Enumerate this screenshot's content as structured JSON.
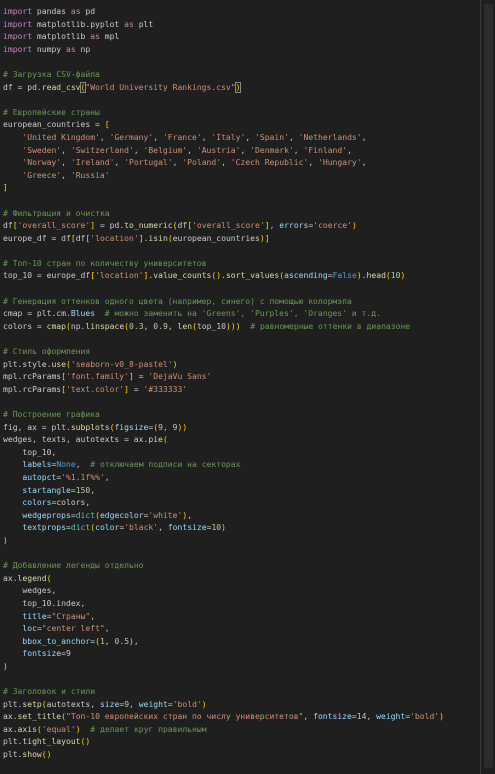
{
  "editor": {
    "lines": [
      [
        {
          "t": "import",
          "c": "kw"
        },
        {
          "t": " pandas ",
          "c": "id"
        },
        {
          "t": "as",
          "c": "kw"
        },
        {
          "t": " pd",
          "c": "id"
        }
      ],
      [
        {
          "t": "import",
          "c": "kw"
        },
        {
          "t": " matplotlib.pyplot ",
          "c": "id"
        },
        {
          "t": "as",
          "c": "kw"
        },
        {
          "t": " plt",
          "c": "id"
        }
      ],
      [
        {
          "t": "import",
          "c": "kw"
        },
        {
          "t": " matplotlib ",
          "c": "id"
        },
        {
          "t": "as",
          "c": "kw"
        },
        {
          "t": " mpl",
          "c": "id"
        }
      ],
      [
        {
          "t": "import",
          "c": "kw"
        },
        {
          "t": " numpy ",
          "c": "id"
        },
        {
          "t": "as",
          "c": "kw"
        },
        {
          "t": " np",
          "c": "id"
        }
      ],
      [],
      [
        {
          "t": "# Загрузка CSV-файла",
          "c": "com"
        }
      ],
      [
        {
          "t": "df = pd.",
          "c": "id"
        },
        {
          "t": "read_csv",
          "c": "fn"
        },
        {
          "t": "(",
          "c": "br",
          "h": true
        },
        {
          "t": "\"World University Rankings.csv\"",
          "c": "str"
        },
        {
          "t": ")",
          "c": "br",
          "h": true
        }
      ],
      [],
      [
        {
          "t": "# Европейские страны",
          "c": "com"
        }
      ],
      [
        {
          "t": "european_countries = ",
          "c": "id"
        },
        {
          "t": "[",
          "c": "br"
        }
      ],
      [
        {
          "t": "    ",
          "c": "id"
        },
        {
          "t": "'United Kingdom'",
          "c": "str"
        },
        {
          "t": ", ",
          "c": "id"
        },
        {
          "t": "'Germany'",
          "c": "str"
        },
        {
          "t": ", ",
          "c": "id"
        },
        {
          "t": "'France'",
          "c": "str"
        },
        {
          "t": ", ",
          "c": "id"
        },
        {
          "t": "'Italy'",
          "c": "str"
        },
        {
          "t": ", ",
          "c": "id"
        },
        {
          "t": "'Spain'",
          "c": "str"
        },
        {
          "t": ", ",
          "c": "id"
        },
        {
          "t": "'Netherlands'",
          "c": "str"
        },
        {
          "t": ",",
          "c": "id"
        }
      ],
      [
        {
          "t": "    ",
          "c": "id"
        },
        {
          "t": "'Sweden'",
          "c": "str"
        },
        {
          "t": ", ",
          "c": "id"
        },
        {
          "t": "'Switzerland'",
          "c": "str"
        },
        {
          "t": ", ",
          "c": "id"
        },
        {
          "t": "'Belgium'",
          "c": "str"
        },
        {
          "t": ", ",
          "c": "id"
        },
        {
          "t": "'Austria'",
          "c": "str"
        },
        {
          "t": ", ",
          "c": "id"
        },
        {
          "t": "'Denmark'",
          "c": "str"
        },
        {
          "t": ", ",
          "c": "id"
        },
        {
          "t": "'Finland'",
          "c": "str"
        },
        {
          "t": ",",
          "c": "id"
        }
      ],
      [
        {
          "t": "    ",
          "c": "id"
        },
        {
          "t": "'Norway'",
          "c": "str"
        },
        {
          "t": ", ",
          "c": "id"
        },
        {
          "t": "'Ireland'",
          "c": "str"
        },
        {
          "t": ", ",
          "c": "id"
        },
        {
          "t": "'Portugal'",
          "c": "str"
        },
        {
          "t": ", ",
          "c": "id"
        },
        {
          "t": "'Poland'",
          "c": "str"
        },
        {
          "t": ", ",
          "c": "id"
        },
        {
          "t": "'Czech Republic'",
          "c": "str"
        },
        {
          "t": ", ",
          "c": "id"
        },
        {
          "t": "'Hungary'",
          "c": "str"
        },
        {
          "t": ",",
          "c": "id"
        }
      ],
      [
        {
          "t": "    ",
          "c": "id"
        },
        {
          "t": "'Greece'",
          "c": "str"
        },
        {
          "t": ", ",
          "c": "id"
        },
        {
          "t": "'Russia'",
          "c": "str"
        }
      ],
      [
        {
          "t": "]",
          "c": "br"
        }
      ],
      [],
      [
        {
          "t": "# Фильтрация и очистка",
          "c": "com"
        }
      ],
      [
        {
          "t": "df",
          "c": "id"
        },
        {
          "t": "[",
          "c": "br"
        },
        {
          "t": "'overall_score'",
          "c": "str"
        },
        {
          "t": "]",
          "c": "br"
        },
        {
          "t": " = pd.",
          "c": "id"
        },
        {
          "t": "to_numeric",
          "c": "fn"
        },
        {
          "t": "(",
          "c": "br"
        },
        {
          "t": "df",
          "c": "id"
        },
        {
          "t": "[",
          "c": "br"
        },
        {
          "t": "'overall_score'",
          "c": "str"
        },
        {
          "t": "]",
          "c": "br"
        },
        {
          "t": ", ",
          "c": "id"
        },
        {
          "t": "errors",
          "c": "var"
        },
        {
          "t": "=",
          "c": "id"
        },
        {
          "t": "'coerce'",
          "c": "str"
        },
        {
          "t": ")",
          "c": "br"
        }
      ],
      [
        {
          "t": "europe_df = df",
          "c": "id"
        },
        {
          "t": "[",
          "c": "br"
        },
        {
          "t": "df",
          "c": "id"
        },
        {
          "t": "[",
          "c": "br"
        },
        {
          "t": "'location'",
          "c": "str"
        },
        {
          "t": "]",
          "c": "br"
        },
        {
          "t": ".",
          "c": "id"
        },
        {
          "t": "isin",
          "c": "fn"
        },
        {
          "t": "(",
          "c": "br"
        },
        {
          "t": "european_countries",
          "c": "id"
        },
        {
          "t": ")",
          "c": "br"
        },
        {
          "t": "]",
          "c": "br"
        }
      ],
      [],
      [
        {
          "t": "# Топ-10 стран по количеству университетов",
          "c": "com"
        }
      ],
      [
        {
          "t": "top_10 = europe_df",
          "c": "id"
        },
        {
          "t": "[",
          "c": "br"
        },
        {
          "t": "'location'",
          "c": "str"
        },
        {
          "t": "]",
          "c": "br"
        },
        {
          "t": ".",
          "c": "id"
        },
        {
          "t": "value_counts",
          "c": "fn"
        },
        {
          "t": "()",
          "c": "br"
        },
        {
          "t": ".",
          "c": "id"
        },
        {
          "t": "sort_values",
          "c": "fn"
        },
        {
          "t": "(",
          "c": "br"
        },
        {
          "t": "ascending",
          "c": "var"
        },
        {
          "t": "=",
          "c": "id"
        },
        {
          "t": "False",
          "c": "const"
        },
        {
          "t": ")",
          "c": "br"
        },
        {
          "t": ".",
          "c": "id"
        },
        {
          "t": "head",
          "c": "fn"
        },
        {
          "t": "(",
          "c": "br"
        },
        {
          "t": "10",
          "c": "num"
        },
        {
          "t": ")",
          "c": "br"
        }
      ],
      [],
      [
        {
          "t": "# Генерация оттенков одного цвета (например, синего) с помощью колормэпа",
          "c": "com"
        }
      ],
      [
        {
          "t": "cmap = plt.cm.",
          "c": "id"
        },
        {
          "t": "Blues",
          "c": "var"
        },
        {
          "t": "  ",
          "c": "id"
        },
        {
          "t": "# можно заменить на 'Greens', 'Purples', 'Oranges' и т.д.",
          "c": "com"
        }
      ],
      [
        {
          "t": "colors = ",
          "c": "id"
        },
        {
          "t": "cmap",
          "c": "fn"
        },
        {
          "t": "(",
          "c": "br"
        },
        {
          "t": "np.",
          "c": "id"
        },
        {
          "t": "linspace",
          "c": "fn"
        },
        {
          "t": "(",
          "c": "br"
        },
        {
          "t": "0.3",
          "c": "num"
        },
        {
          "t": ", ",
          "c": "id"
        },
        {
          "t": "0.9",
          "c": "num"
        },
        {
          "t": ", ",
          "c": "id"
        },
        {
          "t": "len",
          "c": "fn"
        },
        {
          "t": "(",
          "c": "br"
        },
        {
          "t": "top_10",
          "c": "id"
        },
        {
          "t": ")))",
          "c": "br"
        },
        {
          "t": "  ",
          "c": "id"
        },
        {
          "t": "# равномерные оттенки в диапазоне",
          "c": "com"
        }
      ],
      [],
      [
        {
          "t": "# Стиль оформления",
          "c": "com"
        }
      ],
      [
        {
          "t": "plt.style.",
          "c": "id"
        },
        {
          "t": "use",
          "c": "fn"
        },
        {
          "t": "(",
          "c": "br"
        },
        {
          "t": "'seaborn-v0_8-pastel'",
          "c": "str"
        },
        {
          "t": ")",
          "c": "br"
        }
      ],
      [
        {
          "t": "mpl.rcParams",
          "c": "id"
        },
        {
          "t": "[",
          "c": "br"
        },
        {
          "t": "'font.family'",
          "c": "str"
        },
        {
          "t": "]",
          "c": "br"
        },
        {
          "t": " = ",
          "c": "id"
        },
        {
          "t": "'DejaVu Sans'",
          "c": "str"
        }
      ],
      [
        {
          "t": "mpl.rcParams",
          "c": "id"
        },
        {
          "t": "[",
          "c": "br"
        },
        {
          "t": "'text.color'",
          "c": "str"
        },
        {
          "t": "]",
          "c": "br"
        },
        {
          "t": " = ",
          "c": "id"
        },
        {
          "t": "'#333333'",
          "c": "str"
        }
      ],
      [],
      [
        {
          "t": "# Построение графика",
          "c": "com"
        }
      ],
      [
        {
          "t": "fig, ax = plt.",
          "c": "id"
        },
        {
          "t": "subplots",
          "c": "fn"
        },
        {
          "t": "(",
          "c": "br"
        },
        {
          "t": "figsize",
          "c": "var"
        },
        {
          "t": "=",
          "c": "id"
        },
        {
          "t": "(",
          "c": "br"
        },
        {
          "t": "9",
          "c": "num"
        },
        {
          "t": ", ",
          "c": "id"
        },
        {
          "t": "9",
          "c": "num"
        },
        {
          "t": "))",
          "c": "br"
        }
      ],
      [
        {
          "t": "wedges, texts, autotexts = ax.",
          "c": "id"
        },
        {
          "t": "pie",
          "c": "fn"
        },
        {
          "t": "(",
          "c": "br"
        }
      ],
      [
        {
          "t": "    top_10,",
          "c": "id"
        }
      ],
      [
        {
          "t": "    ",
          "c": "id"
        },
        {
          "t": "labels",
          "c": "var"
        },
        {
          "t": "=",
          "c": "id"
        },
        {
          "t": "None",
          "c": "const"
        },
        {
          "t": ",  ",
          "c": "id"
        },
        {
          "t": "# отключаем подписи на секторах",
          "c": "com"
        }
      ],
      [
        {
          "t": "    ",
          "c": "id"
        },
        {
          "t": "autopct",
          "c": "var"
        },
        {
          "t": "=",
          "c": "id"
        },
        {
          "t": "'%1.1f%%'",
          "c": "str"
        },
        {
          "t": ",",
          "c": "id"
        }
      ],
      [
        {
          "t": "    ",
          "c": "id"
        },
        {
          "t": "startangle",
          "c": "var"
        },
        {
          "t": "=",
          "c": "id"
        },
        {
          "t": "150",
          "c": "num"
        },
        {
          "t": ",",
          "c": "id"
        }
      ],
      [
        {
          "t": "    ",
          "c": "id"
        },
        {
          "t": "colors",
          "c": "var"
        },
        {
          "t": "=colors,",
          "c": "id"
        }
      ],
      [
        {
          "t": "    ",
          "c": "id"
        },
        {
          "t": "wedgeprops",
          "c": "var"
        },
        {
          "t": "=",
          "c": "id"
        },
        {
          "t": "dict",
          "c": "cls"
        },
        {
          "t": "(",
          "c": "br"
        },
        {
          "t": "edgecolor",
          "c": "var"
        },
        {
          "t": "=",
          "c": "id"
        },
        {
          "t": "'white'",
          "c": "str"
        },
        {
          "t": ")",
          "c": "br"
        },
        {
          "t": ",",
          "c": "id"
        }
      ],
      [
        {
          "t": "    ",
          "c": "id"
        },
        {
          "t": "textprops",
          "c": "var"
        },
        {
          "t": "=",
          "c": "id"
        },
        {
          "t": "dict",
          "c": "cls"
        },
        {
          "t": "(",
          "c": "br"
        },
        {
          "t": "color",
          "c": "var"
        },
        {
          "t": "=",
          "c": "id"
        },
        {
          "t": "'black'",
          "c": "str"
        },
        {
          "t": ", ",
          "c": "id"
        },
        {
          "t": "fontsize",
          "c": "var"
        },
        {
          "t": "=",
          "c": "id"
        },
        {
          "t": "10",
          "c": "num"
        },
        {
          "t": ")",
          "c": "br"
        }
      ],
      [
        {
          "t": ")",
          "c": "br"
        }
      ],
      [],
      [
        {
          "t": "# Добавление легенды отдельно",
          "c": "com"
        }
      ],
      [
        {
          "t": "ax.",
          "c": "id"
        },
        {
          "t": "legend",
          "c": "fn"
        },
        {
          "t": "(",
          "c": "br"
        }
      ],
      [
        {
          "t": "    wedges,",
          "c": "id"
        }
      ],
      [
        {
          "t": "    top_10.index,",
          "c": "id"
        }
      ],
      [
        {
          "t": "    ",
          "c": "id"
        },
        {
          "t": "title",
          "c": "var"
        },
        {
          "t": "=",
          "c": "id"
        },
        {
          "t": "\"Страны\"",
          "c": "str"
        },
        {
          "t": ",",
          "c": "id"
        }
      ],
      [
        {
          "t": "    ",
          "c": "id"
        },
        {
          "t": "loc",
          "c": "var"
        },
        {
          "t": "=",
          "c": "id"
        },
        {
          "t": "\"center left\"",
          "c": "str"
        },
        {
          "t": ",",
          "c": "id"
        }
      ],
      [
        {
          "t": "    ",
          "c": "id"
        },
        {
          "t": "bbox_to_anchor",
          "c": "var"
        },
        {
          "t": "=",
          "c": "id"
        },
        {
          "t": "(",
          "c": "br"
        },
        {
          "t": "1",
          "c": "num"
        },
        {
          "t": ", ",
          "c": "id"
        },
        {
          "t": "0.5",
          "c": "num"
        },
        {
          "t": ")",
          "c": "br"
        },
        {
          "t": ",",
          "c": "id"
        }
      ],
      [
        {
          "t": "    ",
          "c": "id"
        },
        {
          "t": "fontsize",
          "c": "var"
        },
        {
          "t": "=",
          "c": "id"
        },
        {
          "t": "9",
          "c": "num"
        }
      ],
      [
        {
          "t": ")",
          "c": "br"
        }
      ],
      [],
      [
        {
          "t": "# Заголовок и стили",
          "c": "com"
        }
      ],
      [
        {
          "t": "plt.",
          "c": "id"
        },
        {
          "t": "setp",
          "c": "fn"
        },
        {
          "t": "(",
          "c": "br"
        },
        {
          "t": "autotexts, ",
          "c": "id"
        },
        {
          "t": "size",
          "c": "var"
        },
        {
          "t": "=",
          "c": "id"
        },
        {
          "t": "9",
          "c": "num"
        },
        {
          "t": ", ",
          "c": "id"
        },
        {
          "t": "weight",
          "c": "var"
        },
        {
          "t": "=",
          "c": "id"
        },
        {
          "t": "'bold'",
          "c": "str"
        },
        {
          "t": ")",
          "c": "br"
        }
      ],
      [
        {
          "t": "ax.",
          "c": "id"
        },
        {
          "t": "set_title",
          "c": "fn"
        },
        {
          "t": "(",
          "c": "br"
        },
        {
          "t": "\"Топ-10 европейских стран по числу университетов\"",
          "c": "str"
        },
        {
          "t": ", ",
          "c": "id"
        },
        {
          "t": "fontsize",
          "c": "var"
        },
        {
          "t": "=",
          "c": "id"
        },
        {
          "t": "14",
          "c": "num"
        },
        {
          "t": ", ",
          "c": "id"
        },
        {
          "t": "weight",
          "c": "var"
        },
        {
          "t": "=",
          "c": "id"
        },
        {
          "t": "'bold'",
          "c": "str"
        },
        {
          "t": ")",
          "c": "br"
        }
      ],
      [
        {
          "t": "ax.",
          "c": "id"
        },
        {
          "t": "axis",
          "c": "fn"
        },
        {
          "t": "(",
          "c": "br"
        },
        {
          "t": "'equal'",
          "c": "str"
        },
        {
          "t": ")",
          "c": "br"
        },
        {
          "t": "  ",
          "c": "id"
        },
        {
          "t": "# делает круг правильным",
          "c": "com"
        }
      ],
      [
        {
          "t": "plt.",
          "c": "id"
        },
        {
          "t": "tight_layout",
          "c": "fn"
        },
        {
          "t": "()",
          "c": "br"
        }
      ],
      [
        {
          "t": "plt.",
          "c": "id"
        },
        {
          "t": "show",
          "c": "fn"
        },
        {
          "t": "()",
          "c": "br"
        }
      ]
    ]
  }
}
